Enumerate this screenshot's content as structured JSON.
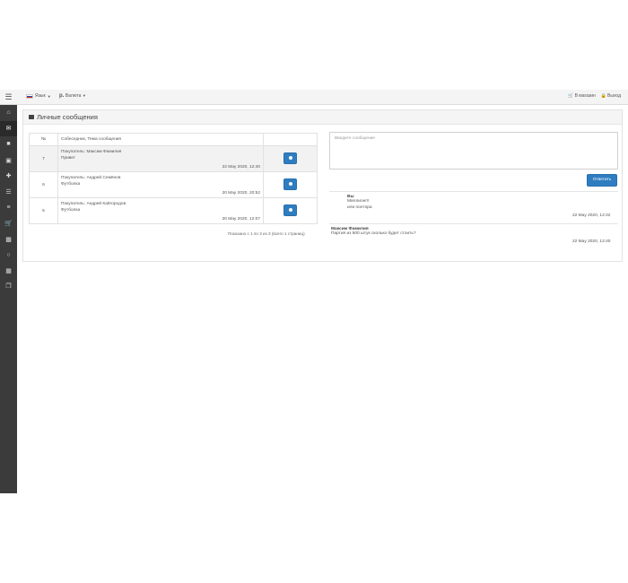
{
  "header": {
    "lang_label": "Язык",
    "currency_symbol": "р.",
    "currency_label": "Валюта",
    "shop_link": "В магазин",
    "logout_link": "Выход"
  },
  "sidebar": {
    "items": [
      {
        "icon": "home-icon"
      },
      {
        "icon": "envelope-icon",
        "active": true
      },
      {
        "icon": "address-book-icon"
      },
      {
        "icon": "id-card-icon"
      },
      {
        "icon": "plus-icon"
      },
      {
        "icon": "list-icon"
      },
      {
        "icon": "list-alt-icon"
      },
      {
        "icon": "cart-icon"
      },
      {
        "icon": "chart-icon"
      },
      {
        "icon": "comments-icon"
      },
      {
        "icon": "money-icon"
      },
      {
        "icon": "copy-icon"
      }
    ]
  },
  "panel": {
    "title": "Личные сообщения"
  },
  "table": {
    "headers": [
      "№",
      "Собеседник, Тема сообщения",
      ""
    ],
    "rows": [
      {
        "num": "7",
        "who": "Покупатель: Максим Фамилия",
        "subject": "Привет",
        "date": "22 May 2020, 12:40",
        "highlight": true
      },
      {
        "num": "6",
        "who": "Покупатель: Андрей Семёнов",
        "subject": "Футболка",
        "date": "20 May 2020, 20:52",
        "highlight": false
      },
      {
        "num": "5",
        "who": "Покупатель: Андрей Кайгородов",
        "subject": "Футболка",
        "date": "20 May 2020, 12:07",
        "highlight": false
      }
    ],
    "pagination": "Показано с 1 по 3 из 3 (всего 1 страниц)"
  },
  "compose": {
    "placeholder": "Введите сообщение",
    "reply_label": "Ответить"
  },
  "messages": [
    {
      "author": "Вы",
      "lines": [
        "Миллион!!!",
        "или полтора"
      ],
      "date": "22 May 2020, 12:42"
    },
    {
      "author": "Максим Фамилия",
      "lines": [
        "Партия из 500 штук сколько будет стоить?"
      ],
      "date": "22 May 2020, 12:40"
    }
  ],
  "colors": {
    "sidebar_bg": "#3b3b3b",
    "primary_button": "#2f7dc1",
    "row_highlight": "#f2f2f2"
  }
}
